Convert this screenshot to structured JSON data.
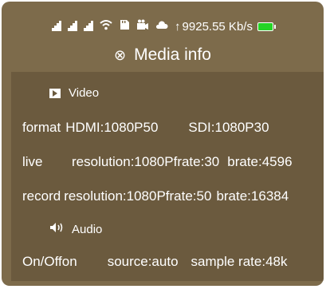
{
  "status": {
    "signal_icons": [
      "signal-icon",
      "signal-icon",
      "signal-icon"
    ],
    "wifi": "wifi-icon",
    "sd": "sd-card-icon",
    "camera": "camera-icon",
    "cloud": "cloud-icon",
    "upload_arrow": "↑",
    "speed": "9925.55 Kb/s",
    "battery_color": "#25d425"
  },
  "title": {
    "icon": "⊗",
    "text": "Media info"
  },
  "video": {
    "header": "Video",
    "format_label": "format",
    "format_hdmi": "HDMI:1080P50",
    "format_sdi": "SDI:1080P30",
    "live_label": "live",
    "live_resolution": "resolution:1080P",
    "live_frate": "frate:30",
    "live_brate": "brate:4596",
    "record_label": "record",
    "record_resolution": "resolution:1080P",
    "record_frate": "frate:50",
    "record_brate": "brate:16384"
  },
  "audio": {
    "header": "Audio",
    "onoff": "On/Off",
    "onoff_value": "on",
    "source": "source:auto",
    "sample_rate": "sample rate:48k"
  },
  "colors": {
    "screen_bg": "#7d6b4b",
    "panel_bg": "#6b5a3e",
    "text": "#ffffff"
  }
}
